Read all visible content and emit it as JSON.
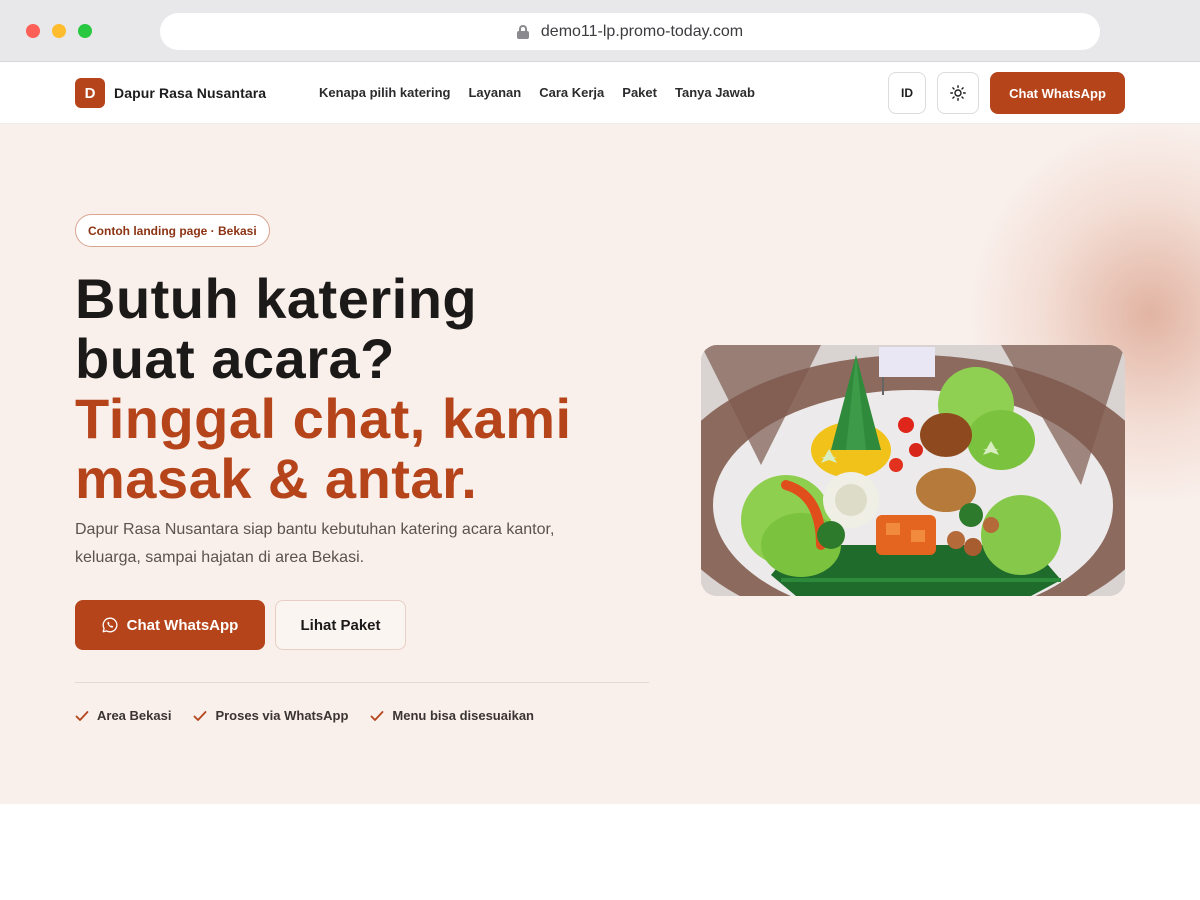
{
  "browser": {
    "url": "demo11-lp.promo-today.com"
  },
  "header": {
    "logo_letter": "D",
    "brand_name": "Dapur Rasa Nusantara",
    "nav": [
      {
        "label": "Kenapa pilih katering"
      },
      {
        "label": "Layanan"
      },
      {
        "label": "Cara Kerja"
      },
      {
        "label": "Paket"
      },
      {
        "label": "Tanya Jawab"
      }
    ],
    "lang_label": "ID",
    "theme_icon": "sun-icon",
    "cta_label": "Chat WhatsApp"
  },
  "hero": {
    "badge": "Contoh landing page · Bekasi",
    "headline_line1": "Butuh katering",
    "headline_line2": "buat acara?",
    "headline_accent1": "Tinggal chat, kami",
    "headline_accent2": "masak & antar.",
    "subtitle": "Dapur Rasa Nusantara siap bantu kebutuhan katering acara kantor, keluarga, sampai hajatan di area Bekasi.",
    "primary_cta": "Chat WhatsApp",
    "primary_cta_icon": "whatsapp-icon",
    "secondary_cta": "Lihat Paket",
    "features": [
      {
        "label": "Area Bekasi",
        "icon": "check-icon"
      },
      {
        "label": "Proses via WhatsApp",
        "icon": "check-icon"
      },
      {
        "label": "Menu bisa disesuaikan",
        "icon": "check-icon"
      }
    ],
    "image_alt": "tumpeng-photo"
  },
  "colors": {
    "accent": "#b5441b",
    "hero_bg": "#f9efeb",
    "text_dark": "#1c1a19"
  }
}
